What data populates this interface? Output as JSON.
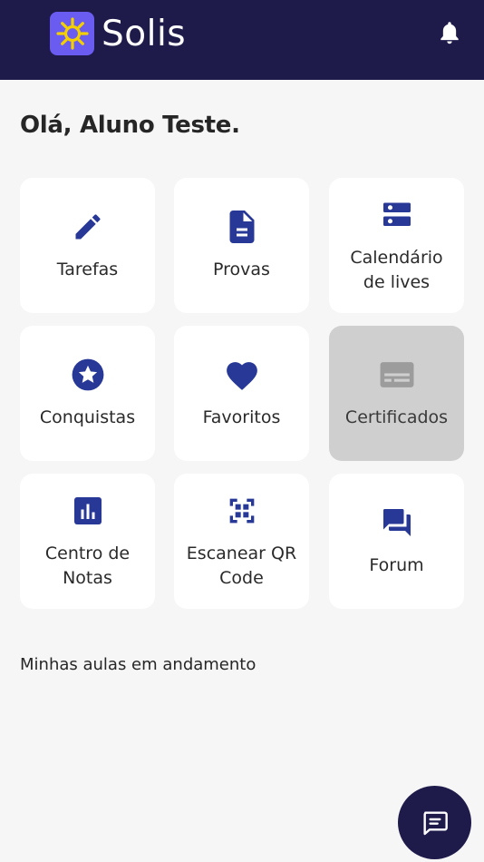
{
  "header": {
    "app_name": "Solis",
    "logo_icon": "sun-icon",
    "notifications_icon": "bell-icon"
  },
  "greeting": "Olá, Aluno Teste.",
  "menu": [
    {
      "label": "Tarefas",
      "icon": "pencil-icon"
    },
    {
      "label": "Provas",
      "icon": "document-icon"
    },
    {
      "label": "Calendário\nde lives",
      "icon": "server-icon"
    },
    {
      "label": "Conquistas",
      "icon": "star-badge-icon"
    },
    {
      "label": "Favoritos",
      "icon": "heart-icon"
    },
    {
      "label": "Certificados",
      "icon": "certificate-icon",
      "disabled": true
    },
    {
      "label": "Centro de\nNotas",
      "icon": "bar-chart-icon"
    },
    {
      "label": "Escanear QR\nCode",
      "icon": "qr-scan-icon"
    },
    {
      "label": "Forum",
      "icon": "forum-icon"
    }
  ],
  "section": {
    "title": "Minhas aulas em andamento"
  },
  "chat_button": {
    "icon": "chat-icon"
  },
  "colors": {
    "header_bg": "#1e1b4b",
    "icon_primary": "#273896",
    "logo_bg": "#6a5cf0",
    "logo_sun": "#f5d000",
    "card_bg": "#ffffff",
    "card_disabled_bg": "#cfcfcf",
    "page_bg": "#f6f6f6"
  }
}
